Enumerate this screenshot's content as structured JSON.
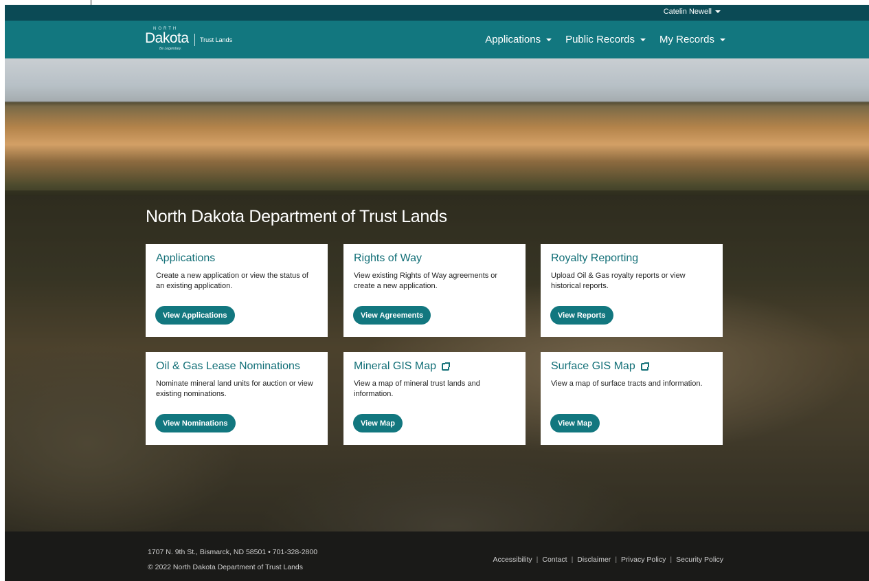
{
  "topbar": {
    "user_name": "Catelin Newell"
  },
  "brand": {
    "north": "NORTH",
    "dakota": "Dakota",
    "tagline": "Be Legendary.",
    "sub": "Trust Lands"
  },
  "nav": {
    "items": [
      {
        "label": "Applications"
      },
      {
        "label": "Public Records"
      },
      {
        "label": "My Records"
      }
    ]
  },
  "hero": {
    "title": "North Dakota Department of Trust Lands"
  },
  "cards": [
    {
      "title": "Applications",
      "text": "Create a new application or view the status of an existing application.",
      "button": "View Applications",
      "external": false
    },
    {
      "title": "Rights of Way",
      "text": "View existing Rights of Way agreements or create a new application.",
      "button": "View Agreements",
      "external": false
    },
    {
      "title": "Royalty Reporting",
      "text": "Upload Oil & Gas royalty reports or view historical reports.",
      "button": "View Reports",
      "external": false
    },
    {
      "title": "Oil & Gas Lease Nominations",
      "text": "Nominate mineral land units for auction or view existing nominations.",
      "button": "View Nominations",
      "external": false
    },
    {
      "title": "Mineral GIS Map",
      "text": "View a map of mineral trust lands and information.",
      "button": "View Map",
      "external": true
    },
    {
      "title": "Surface GIS Map",
      "text": "View a map of surface tracts and information.",
      "button": "View Map",
      "external": true
    }
  ],
  "footer": {
    "address": "1707 N. 9th St., Bismarck, ND 58501  •  701-328-2800",
    "copyright": "© 2022 North Dakota Department of Trust Lands",
    "links": [
      "Accessibility",
      "Contact",
      "Disclaimer",
      "Privacy Policy",
      "Security Policy"
    ]
  },
  "colors": {
    "topbar": "#0b4a55",
    "navbar": "#12777f",
    "accent": "#126f77",
    "footer": "#1a1a18"
  }
}
